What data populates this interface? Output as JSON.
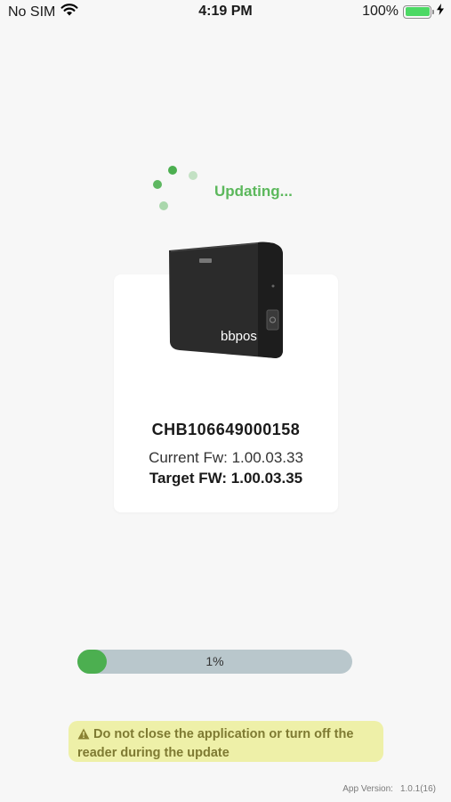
{
  "status_bar": {
    "carrier": "No SIM",
    "time": "4:19 PM",
    "battery_percent": "100%"
  },
  "update": {
    "status_label": "Updating...",
    "serial": "CHB106649000158",
    "current_fw": "Current Fw: 1.00.03.33",
    "target_fw": "Target FW: 1.00.03.35"
  },
  "device_image": {
    "brand": "bbpos"
  },
  "progress": {
    "label": "1%",
    "value_fraction": 0.01
  },
  "warning": {
    "text": "Do not close the application or turn off the reader during the update"
  },
  "footer": {
    "app_version_label": "App Version:",
    "app_version_value": "1.0.1(16)"
  },
  "colors": {
    "accent_green": "#4caf50",
    "warning_bg": "#eef0a8",
    "warning_text": "#7e7a32",
    "progress_track": "#b9c7cc"
  }
}
